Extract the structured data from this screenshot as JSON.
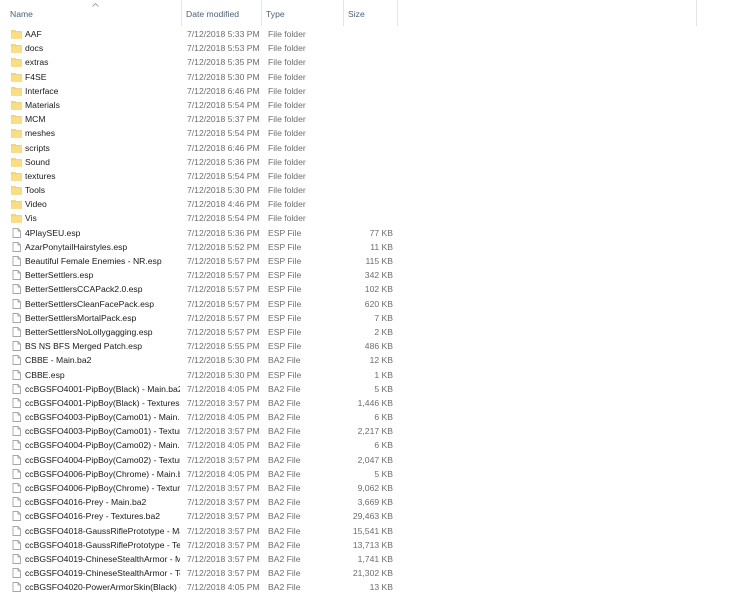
{
  "header": {
    "name": "Name",
    "date": "Date modified",
    "type": "Type",
    "size": "Size"
  },
  "colors": {
    "folder": "#f8d775",
    "folder_dark": "#e3b94a",
    "header_text": "#4c607a"
  },
  "files": [
    {
      "name": "AAF",
      "date": "7/12/2018 5:33 PM",
      "type": "File folder",
      "size": "",
      "icon": "folder-icon"
    },
    {
      "name": "docs",
      "date": "7/12/2018 5:53 PM",
      "type": "File folder",
      "size": "",
      "icon": "folder-icon"
    },
    {
      "name": "extras",
      "date": "7/12/2018 5:35 PM",
      "type": "File folder",
      "size": "",
      "icon": "folder-icon"
    },
    {
      "name": "F4SE",
      "date": "7/12/2018 5:30 PM",
      "type": "File folder",
      "size": "",
      "icon": "folder-icon"
    },
    {
      "name": "Interface",
      "date": "7/12/2018 6:46 PM",
      "type": "File folder",
      "size": "",
      "icon": "folder-icon"
    },
    {
      "name": "Materials",
      "date": "7/12/2018 5:54 PM",
      "type": "File folder",
      "size": "",
      "icon": "folder-icon"
    },
    {
      "name": "MCM",
      "date": "7/12/2018 5:37 PM",
      "type": "File folder",
      "size": "",
      "icon": "folder-icon"
    },
    {
      "name": "meshes",
      "date": "7/12/2018 5:54 PM",
      "type": "File folder",
      "size": "",
      "icon": "folder-icon"
    },
    {
      "name": "scripts",
      "date": "7/12/2018 6:46 PM",
      "type": "File folder",
      "size": "",
      "icon": "folder-icon"
    },
    {
      "name": "Sound",
      "date": "7/12/2018 5:36 PM",
      "type": "File folder",
      "size": "",
      "icon": "folder-icon"
    },
    {
      "name": "textures",
      "date": "7/12/2018 5:54 PM",
      "type": "File folder",
      "size": "",
      "icon": "folder-icon"
    },
    {
      "name": "Tools",
      "date": "7/12/2018 5:30 PM",
      "type": "File folder",
      "size": "",
      "icon": "folder-icon"
    },
    {
      "name": "Video",
      "date": "7/12/2018 4:46 PM",
      "type": "File folder",
      "size": "",
      "icon": "folder-icon"
    },
    {
      "name": "Vis",
      "date": "7/12/2018 5:54 PM",
      "type": "File folder",
      "size": "",
      "icon": "folder-icon"
    },
    {
      "name": "4PlaySEU.esp",
      "date": "7/12/2018 5:36 PM",
      "type": "ESP File",
      "size": "77 KB",
      "icon": "file-icon"
    },
    {
      "name": "AzarPonytailHairstyles.esp",
      "date": "7/12/2018 5:52 PM",
      "type": "ESP File",
      "size": "11 KB",
      "icon": "file-icon"
    },
    {
      "name": "Beautiful Female Enemies - NR.esp",
      "date": "7/12/2018 5:57 PM",
      "type": "ESP File",
      "size": "115 KB",
      "icon": "file-icon"
    },
    {
      "name": "BetterSettlers.esp",
      "date": "7/12/2018 5:57 PM",
      "type": "ESP File",
      "size": "342 KB",
      "icon": "file-icon"
    },
    {
      "name": "BetterSettlersCCAPack2.0.esp",
      "date": "7/12/2018 5:57 PM",
      "type": "ESP File",
      "size": "102 KB",
      "icon": "file-icon"
    },
    {
      "name": "BetterSettlersCleanFacePack.esp",
      "date": "7/12/2018 5:57 PM",
      "type": "ESP File",
      "size": "620 KB",
      "icon": "file-icon"
    },
    {
      "name": "BetterSettlersMortalPack.esp",
      "date": "7/12/2018 5:57 PM",
      "type": "ESP File",
      "size": "7 KB",
      "icon": "file-icon"
    },
    {
      "name": "BetterSettlersNoLollygagging.esp",
      "date": "7/12/2018 5:57 PM",
      "type": "ESP File",
      "size": "2 KB",
      "icon": "file-icon"
    },
    {
      "name": "BS NS BFS Merged Patch.esp",
      "date": "7/12/2018 5:55 PM",
      "type": "ESP File",
      "size": "486 KB",
      "icon": "file-icon"
    },
    {
      "name": "CBBE - Main.ba2",
      "date": "7/12/2018 5:30 PM",
      "type": "BA2 File",
      "size": "12 KB",
      "icon": "file-icon"
    },
    {
      "name": "CBBE.esp",
      "date": "7/12/2018 5:30 PM",
      "type": "ESP File",
      "size": "1 KB",
      "icon": "file-icon"
    },
    {
      "name": "ccBGSFO4001-PipBoy(Black) - Main.ba2",
      "date": "7/12/2018 4:05 PM",
      "type": "BA2 File",
      "size": "5 KB",
      "icon": "file-icon"
    },
    {
      "name": "ccBGSFO4001-PipBoy(Black) - Textures.ba2",
      "date": "7/12/2018 3:57 PM",
      "type": "BA2 File",
      "size": "1,446 KB",
      "icon": "file-icon"
    },
    {
      "name": "ccBGSFO4003-PipBoy(Camo01) - Main.ba2",
      "date": "7/12/2018 4:05 PM",
      "type": "BA2 File",
      "size": "6 KB",
      "icon": "file-icon"
    },
    {
      "name": "ccBGSFO4003-PipBoy(Camo01) - Texture...",
      "date": "7/12/2018 3:57 PM",
      "type": "BA2 File",
      "size": "2,217 KB",
      "icon": "file-icon"
    },
    {
      "name": "ccBGSFO4004-PipBoy(Camo02) - Main.ba2",
      "date": "7/12/2018 4:05 PM",
      "type": "BA2 File",
      "size": "6 KB",
      "icon": "file-icon"
    },
    {
      "name": "ccBGSFO4004-PipBoy(Camo02) - Texture...",
      "date": "7/12/2018 3:57 PM",
      "type": "BA2 File",
      "size": "2,047 KB",
      "icon": "file-icon"
    },
    {
      "name": "ccBGSFO4006-PipBoy(Chrome) - Main.ba2",
      "date": "7/12/2018 4:05 PM",
      "type": "BA2 File",
      "size": "5 KB",
      "icon": "file-icon"
    },
    {
      "name": "ccBGSFO4006-PipBoy(Chrome) - Texture...",
      "date": "7/12/2018 3:57 PM",
      "type": "BA2 File",
      "size": "9,062 KB",
      "icon": "file-icon"
    },
    {
      "name": "ccBGSFO4016-Prey - Main.ba2",
      "date": "7/12/2018 3:57 PM",
      "type": "BA2 File",
      "size": "3,669 KB",
      "icon": "file-icon"
    },
    {
      "name": "ccBGSFO4016-Prey - Textures.ba2",
      "date": "7/12/2018 3:57 PM",
      "type": "BA2 File",
      "size": "29,463 KB",
      "icon": "file-icon"
    },
    {
      "name": "ccBGSFO4018-GaussRiflePrototype - Mai...",
      "date": "7/12/2018 3:57 PM",
      "type": "BA2 File",
      "size": "15,541 KB",
      "icon": "file-icon"
    },
    {
      "name": "ccBGSFO4018-GaussRiflePrototype - Text...",
      "date": "7/12/2018 3:57 PM",
      "type": "BA2 File",
      "size": "13,713 KB",
      "icon": "file-icon"
    },
    {
      "name": "ccBGSFO4019-ChineseStealthArmor - Ma...",
      "date": "7/12/2018 3:57 PM",
      "type": "BA2 File",
      "size": "1,741 KB",
      "icon": "file-icon"
    },
    {
      "name": "ccBGSFO4019-ChineseStealthArmor - Tex...",
      "date": "7/12/2018 3:57 PM",
      "type": "BA2 File",
      "size": "21,302 KB",
      "icon": "file-icon"
    },
    {
      "name": "ccBGSFO4020-PowerArmorSkin(Black) -...",
      "date": "7/12/2018 4:05 PM",
      "type": "BA2 File",
      "size": "13 KB",
      "icon": "file-icon"
    }
  ]
}
